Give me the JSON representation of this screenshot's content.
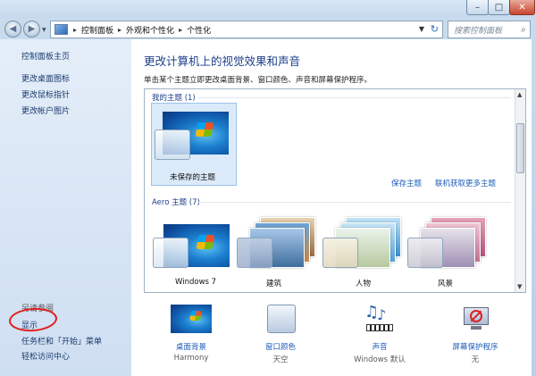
{
  "window": {
    "minimize_glyph": "–",
    "maximize_glyph": "□",
    "close_glyph": "✕"
  },
  "navigation": {
    "back_icon": "back-arrow-icon",
    "forward_icon": "forward-arrow-icon",
    "breadcrumb": [
      "控制面板",
      "外观和个性化",
      "个性化"
    ],
    "separator": "▸",
    "search_placeholder": "搜索控制面板"
  },
  "sidebar": {
    "items": [
      {
        "label": "控制面板主页"
      },
      {
        "label": "更改桌面图标"
      },
      {
        "label": "更改鼠标指针"
      },
      {
        "label": "更改帐户图片"
      }
    ],
    "see_also_label": "另请参阅",
    "see_also_items": [
      {
        "label": "显示"
      },
      {
        "label": "任务栏和「开始」菜单"
      },
      {
        "label": "轻松访问中心"
      }
    ],
    "annotation_color": "#e02020"
  },
  "main": {
    "title": "更改计算机上的视觉效果和声音",
    "description": "单击某个主题立即更改桌面背景、窗口颜色、声音和屏幕保护程序。",
    "my_themes_label": "我的主题 (1)",
    "unsaved_theme_label": "未保存的主题",
    "save_theme_link": "保存主题",
    "get_more_link": "联机获取更多主题",
    "aero_themes_label": "Aero 主题 (7)",
    "aero_themes": [
      {
        "label": "Windows 7"
      },
      {
        "label": "建筑"
      },
      {
        "label": "人物"
      },
      {
        "label": "风景"
      }
    ],
    "settings": [
      {
        "label": "桌面背景",
        "value": "Harmony",
        "icon": "desktop-background-icon"
      },
      {
        "label": "窗口颜色",
        "value": "天空",
        "icon": "window-color-icon"
      },
      {
        "label": "声音",
        "value": "Windows 默认",
        "icon": "music-notes-icon"
      },
      {
        "label": "屏幕保护程序",
        "value": "无",
        "icon": "screensaver-icon"
      }
    ]
  }
}
